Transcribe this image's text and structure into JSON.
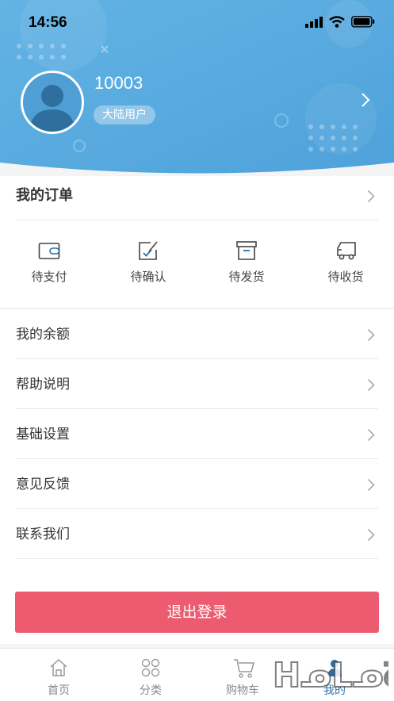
{
  "status_bar": {
    "time": "14:56"
  },
  "profile": {
    "username": "10003",
    "tag": "大陆用户"
  },
  "orders": {
    "title": "我的订单",
    "items": [
      {
        "label": "待支付",
        "icon": "wallet-icon"
      },
      {
        "label": "待确认",
        "icon": "edit-check-icon"
      },
      {
        "label": "待发货",
        "icon": "box-icon"
      },
      {
        "label": "待收货",
        "icon": "truck-icon"
      }
    ]
  },
  "menu": [
    {
      "label": "我的余额"
    },
    {
      "label": "帮助说明"
    },
    {
      "label": "基础设置"
    },
    {
      "label": "意见反馈"
    },
    {
      "label": "联系我们"
    }
  ],
  "logout_label": "退出登录",
  "tabbar": {
    "active": "我的",
    "items": [
      {
        "label": "首页",
        "icon": "home-icon"
      },
      {
        "label": "分类",
        "icon": "grid-icon"
      },
      {
        "label": "购物车",
        "icon": "cart-icon"
      },
      {
        "label": "我的",
        "icon": "user-icon"
      }
    ]
  },
  "watermark_text": "ᕼᓄᒪᓄᘔ",
  "colors": {
    "header_blue": "#56a8dd",
    "logout_red": "#ec5b6f",
    "active_tab": "#2b6fa8"
  }
}
